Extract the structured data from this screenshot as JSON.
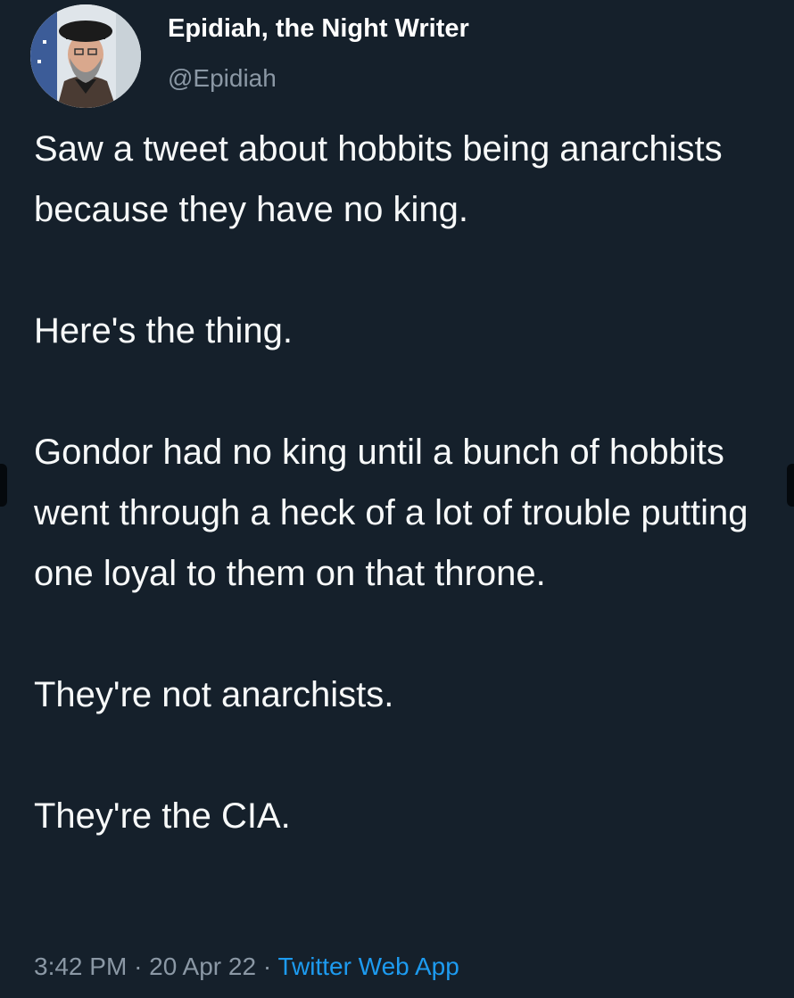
{
  "author": {
    "display_name": "Epidiah, the Night Writer",
    "handle": "@Epidiah"
  },
  "tweet": {
    "paragraphs": [
      "Saw a tweet about hobbits being anarchists because they have no king.",
      "Here's the thing.",
      "Gondor had no king until a bunch of hobbits went through a heck of a lot of trouble putting one loyal to them on that throne.",
      "They're not anarchists.",
      "They're the CIA."
    ],
    "time": "3:42 PM",
    "separator": "·",
    "date": "20 Apr 22",
    "source": "Twitter Web App"
  },
  "colors": {
    "background": "#15202b",
    "text": "#f7f9f9",
    "secondary_text": "#8b98a5",
    "link": "#1d9bf0"
  }
}
